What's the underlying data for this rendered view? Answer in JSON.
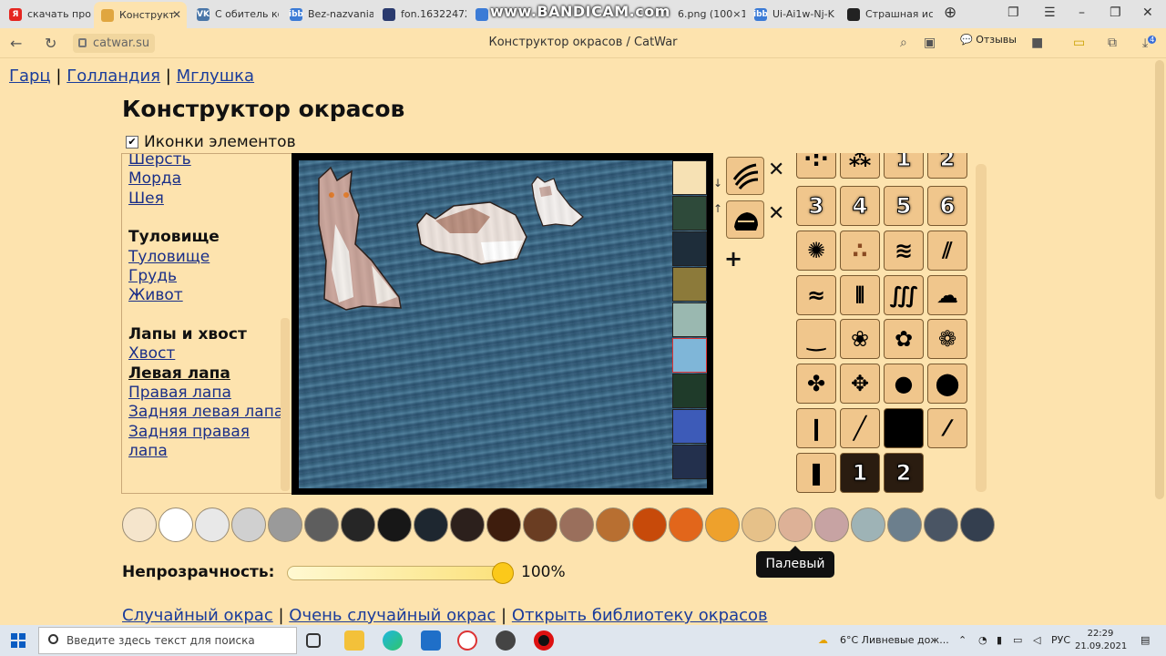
{
  "browser": {
    "tabs": [
      {
        "label": "скачать прог",
        "favicon_color": "#e52620",
        "favicon_text": "Я"
      },
      {
        "label": "Конструкт",
        "favicon_color": "#e0a640",
        "favicon_text": ""
      },
      {
        "label": "С обитель ко",
        "favicon_color": "#4a76a8",
        "favicon_text": "VK"
      },
      {
        "label": "Bez-nazvania",
        "favicon_color": "#3b7bd6",
        "favicon_text": "ibb"
      },
      {
        "label": "fon.16322472",
        "favicon_color": "#2a3a6e",
        "favicon_text": ""
      },
      {
        "label": "6.png (100×1",
        "favicon_color": "#3b7bd6",
        "favicon_text": ""
      },
      {
        "label": "Ui-Ai1w-Nj-K",
        "favicon_color": "#3b7bd6",
        "favicon_text": "ibb"
      },
      {
        "label": "Страшная ис",
        "favicon_color": "#222222",
        "favicon_text": ""
      }
    ],
    "watermark": "www.BANDICAM.com",
    "url": "catwar.su",
    "page_title": "Конструктор окрасов / CatWar",
    "feedback_label": "Отзывы",
    "downloads_badge": "4"
  },
  "breadcrumbs": {
    "items": [
      "Гарц",
      "Голландия",
      "Мглушка"
    ],
    "separator": "|"
  },
  "heading": "Конструктор окрасов",
  "icons_toggle": {
    "label": "Иконки элементов",
    "checked": true,
    "mark": "✔"
  },
  "parts": {
    "head_items": [
      "Шерсть",
      "Морда",
      "Шея"
    ],
    "groups": [
      {
        "title": "Туловище",
        "items": [
          "Туловище",
          "Грудь",
          "Живот"
        ]
      },
      {
        "title": "Лапы и хвост",
        "items": [
          "Хвост",
          "Левая лапа",
          "Правая лапа",
          "Задняя левая лапа",
          "Задняя правая лапа"
        ]
      }
    ],
    "current": "Левая лапа"
  },
  "backgrounds": {
    "colors": [
      "#f6e1b4",
      "#2e4a3a",
      "#1e2d3a",
      "#8c7a3a",
      "#9ab8b0",
      "#7fb6d8",
      "#1f3b2a",
      "#3d5bb8",
      "#23304d"
    ]
  },
  "layers": {
    "remove_label": "✕",
    "add_label": "+",
    "up_label": "↑",
    "down_label": "↓"
  },
  "patterns": {
    "rows": [
      [
        "",
        "",
        "1",
        "2"
      ],
      [
        "3",
        "4",
        "5",
        "6"
      ],
      [
        "",
        "",
        "",
        ""
      ],
      [
        "",
        "",
        "",
        ""
      ],
      [
        "",
        "",
        "",
        ""
      ],
      [
        "",
        "",
        "",
        ""
      ],
      [
        "",
        "",
        "",
        ""
      ],
      [
        "",
        "1",
        "2"
      ]
    ]
  },
  "palette": {
    "colors": [
      "#f5e5cc",
      "#ffffff",
      "#e8e8e8",
      "#d0d0d0",
      "#9a9a9a",
      "#5e5e5e",
      "#262626",
      "#171717",
      "#1e2730",
      "#2c201c",
      "#3e1d0d",
      "#6a3d22",
      "#9a6f5c",
      "#b86f31",
      "#c74a0a",
      "#e2661b",
      "#eea12c",
      "#e6c189",
      "#ddb197",
      "#c7a3a3",
      "#9eb3b6",
      "#6c7f8d",
      "#4a5564",
      "#343f4f"
    ],
    "tooltip": "Палевый"
  },
  "opacity": {
    "label": "Непрозрачность:",
    "value": "100%",
    "level": 1.0
  },
  "bottom_links": [
    "Случайный окрас",
    "Очень случайный окрас",
    "Открыть библиотеку окрасов"
  ],
  "taskbar": {
    "search_placeholder": "Введите здесь текст для поиска",
    "weather": "6°C  Ливневые дож...",
    "lang": "РУС",
    "time": "22:29",
    "date": "21.09.2021"
  }
}
